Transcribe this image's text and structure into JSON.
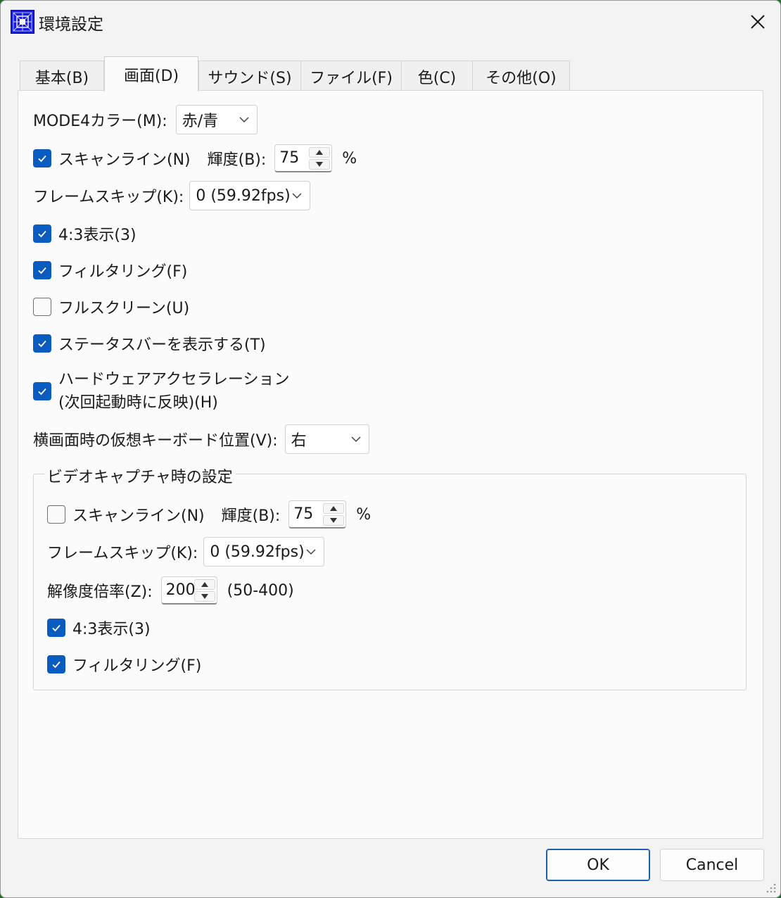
{
  "window": {
    "title": "環境設定"
  },
  "tabs": [
    {
      "label": "基本(B)"
    },
    {
      "label": "画面(D)"
    },
    {
      "label": "サウンド(S)"
    },
    {
      "label": "ファイル(F)"
    },
    {
      "label": "色(C)"
    },
    {
      "label": "その他(O)"
    }
  ],
  "active_tab": "画面(D)",
  "screen": {
    "mode4_label": "MODE4カラー(M):",
    "mode4_value": "赤/青",
    "scanline": {
      "label": "スキャンライン(N)",
      "checked": true
    },
    "brightness": {
      "label": "輝度(B):",
      "value": "75",
      "unit": "%"
    },
    "frameskip": {
      "label": "フレームスキップ(K):",
      "value": "0 (59.92fps)"
    },
    "aspect43": {
      "label": "4:3表示(3)",
      "checked": true
    },
    "filtering": {
      "label": "フィルタリング(F)",
      "checked": true
    },
    "fullscreen": {
      "label": "フルスクリーン(U)",
      "checked": false
    },
    "statusbar": {
      "label": "ステータスバーを表示する(T)",
      "checked": true
    },
    "hwaccel": {
      "label_line1": "ハードウェアアクセラレーション",
      "label_line2": "(次回起動時に反映)(H)",
      "checked": true
    },
    "vkeyboard": {
      "label": "横画面時の仮想キーボード位置(V):",
      "value": "右"
    }
  },
  "video_capture": {
    "title": "ビデオキャプチャ時の設定",
    "scanline": {
      "label": "スキャンライン(N)",
      "checked": false
    },
    "brightness": {
      "label": "輝度(B):",
      "value": "75",
      "unit": "%"
    },
    "frameskip": {
      "label": "フレームスキップ(K):",
      "value": "0 (59.92fps)"
    },
    "resolution": {
      "label": "解像度倍率(Z):",
      "value": "200",
      "range": "(50-400)"
    },
    "aspect43": {
      "label": "4:3表示(3)",
      "checked": true
    },
    "filtering": {
      "label": "フィルタリング(F)",
      "checked": true
    }
  },
  "buttons": {
    "ok": "OK",
    "cancel": "Cancel"
  },
  "colors": {
    "accent": "#0a5bc0",
    "window_bg": "#f3f3f3",
    "panel_bg": "#fbfbfb"
  },
  "icons": {
    "close": "close-icon",
    "app": "app-icon",
    "check": "check-icon",
    "chevron": "chevron-down-icon"
  }
}
